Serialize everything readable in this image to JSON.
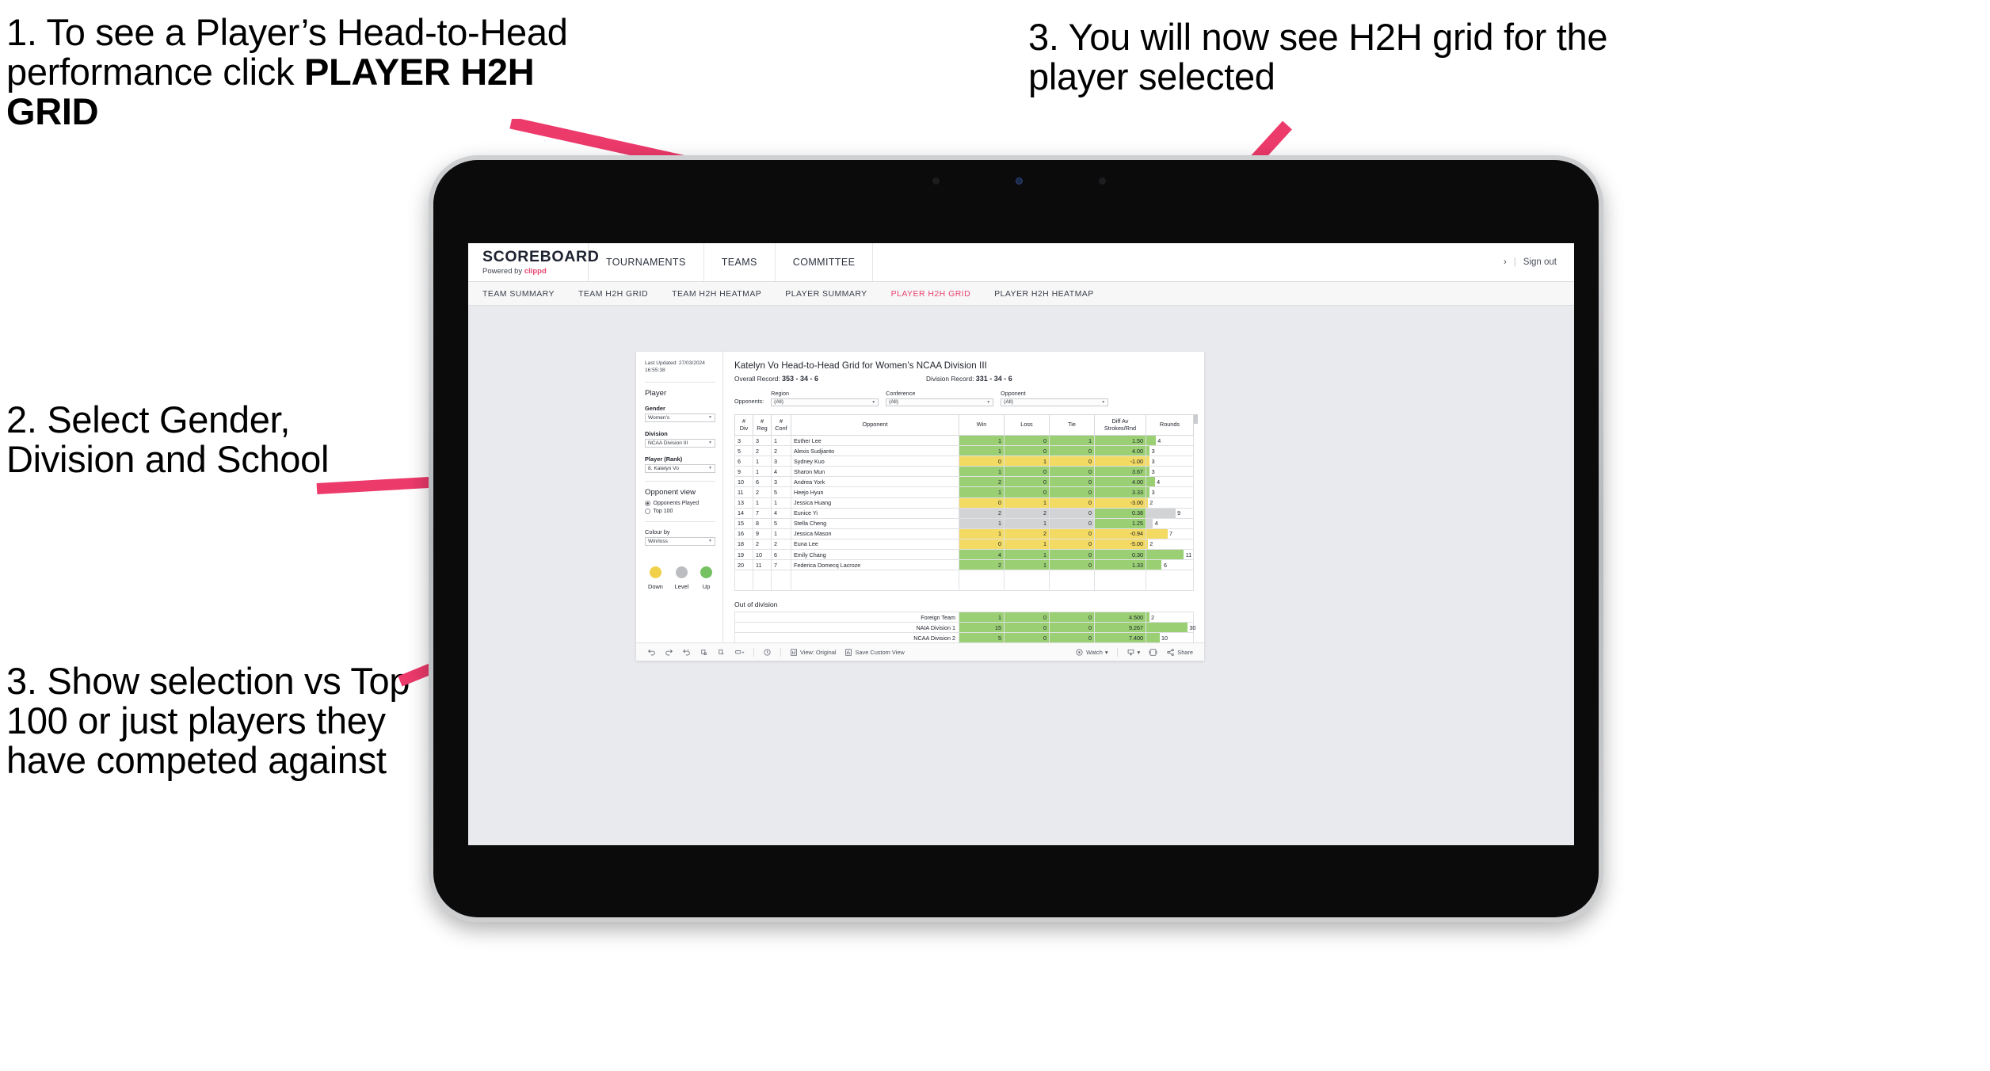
{
  "annotations": [
    {
      "id": "anno-1",
      "text_plain": "1. To see a Player’s Head-to-Head performance click ",
      "text_bold": "PLAYER H2H GRID"
    },
    {
      "id": "anno-2",
      "text": "2. Select Gender, Division and School"
    },
    {
      "id": "anno-3",
      "text": "3. Show selection vs Top 100 or just players they have competed against"
    },
    {
      "id": "anno-4",
      "text": "3. You will now see H2H grid for the player selected"
    }
  ],
  "arrow_color": "#ec3a6b",
  "app": {
    "brand": {
      "name": "SCOREBOARD",
      "sub_prefix": "Powered by ",
      "sub_brand": "clippd"
    },
    "topnav": [
      {
        "label": "TOURNAMENTS"
      },
      {
        "label": "TEAMS"
      },
      {
        "label": "COMMITTEE"
      }
    ],
    "topbar_right": {
      "chevron": "›",
      "separator": "|",
      "sign_out": "Sign out"
    },
    "subnav": [
      {
        "label": "TEAM SUMMARY",
        "active": false
      },
      {
        "label": "TEAM H2H GRID",
        "active": false
      },
      {
        "label": "TEAM H2H HEATMAP",
        "active": false
      },
      {
        "label": "PLAYER SUMMARY",
        "active": false
      },
      {
        "label": "PLAYER H2H GRID",
        "active": true
      },
      {
        "label": "PLAYER H2H HEATMAP",
        "active": false
      }
    ],
    "accent_color": "#e8436f"
  },
  "panel": {
    "last_updated": "Last Updated: 27/03/2024 16:55:38",
    "section_title": "Player",
    "filters": [
      {
        "label": "Gender",
        "value": "Women's"
      },
      {
        "label": "Division",
        "value": "NCAA Division III"
      },
      {
        "label": "Player (Rank)",
        "value": "8. Katelyn Vo"
      }
    ],
    "opponent_view": {
      "title": "Opponent view",
      "options": [
        {
          "label": "Opponents Played",
          "selected": true
        },
        {
          "label": "Top 100",
          "selected": false
        }
      ]
    },
    "colour_by": {
      "label": "Colour by",
      "value": "Win/loss"
    },
    "legend": [
      {
        "label": "Down",
        "color": "#f1d04a"
      },
      {
        "label": "Level",
        "color": "#bcbdc0"
      },
      {
        "label": "Up",
        "color": "#74c261"
      }
    ]
  },
  "content": {
    "title": "Katelyn Vo Head-to-Head Grid for Women’s NCAA Division III",
    "overall_record_label": "Overall Record:",
    "overall_record_value": "353 - 34 - 6",
    "division_record_label": "Division Record:",
    "division_record_value": "331 - 34 - 6",
    "opponents_label": "Opponents:",
    "opponent_filters": [
      {
        "label": "Region",
        "value": "(All)"
      },
      {
        "label": "Conference",
        "value": "(All)"
      },
      {
        "label": "Opponent",
        "value": "(All)"
      }
    ],
    "out_of_division_title": "Out of division"
  },
  "chart_data": {
    "type": "table",
    "title": "Katelyn Vo Head-to-Head Grid for Women’s NCAA Division III",
    "columns": [
      "# Div",
      "# Reg",
      "# Conf",
      "Opponent",
      "Win",
      "Loss",
      "Tie",
      "Diff Av Strokes/Rnd",
      "Rounds"
    ],
    "column_headers_multiline": [
      [
        "#",
        "Div"
      ],
      [
        "#",
        "Reg"
      ],
      [
        "#",
        "Conf"
      ],
      [
        "Opponent"
      ],
      [
        "Win"
      ],
      [
        "Loss"
      ],
      [
        "Tie"
      ],
      [
        "Diff Av",
        "Strokes/Rnd"
      ],
      [
        "Rounds"
      ]
    ],
    "rows": [
      {
        "div": "3",
        "reg": "3",
        "conf": "1",
        "opponent": "Esther Lee",
        "win": "1",
        "loss": "0",
        "tie": "1",
        "diff": "1.50",
        "rounds": "4",
        "state": "up",
        "rounds_pct": 20
      },
      {
        "div": "5",
        "reg": "2",
        "conf": "2",
        "opponent": "Alexis Sudjianto",
        "win": "1",
        "loss": "0",
        "tie": "0",
        "diff": "4.00",
        "rounds": "3",
        "state": "up",
        "rounds_pct": 7
      },
      {
        "div": "6",
        "reg": "1",
        "conf": "3",
        "opponent": "Sydney Kuo",
        "win": "0",
        "loss": "1",
        "tie": "0",
        "diff": "-1.00",
        "rounds": "3",
        "state": "down",
        "rounds_pct": 7
      },
      {
        "div": "9",
        "reg": "1",
        "conf": "4",
        "opponent": "Sharon Mun",
        "win": "1",
        "loss": "0",
        "tie": "0",
        "diff": "3.67",
        "rounds": "3",
        "state": "up",
        "rounds_pct": 7
      },
      {
        "div": "10",
        "reg": "6",
        "conf": "3",
        "opponent": "Andrea York",
        "win": "2",
        "loss": "0",
        "tie": "0",
        "diff": "4.00",
        "rounds": "4",
        "state": "up",
        "rounds_pct": 18
      },
      {
        "div": "11",
        "reg": "2",
        "conf": "5",
        "opponent": "Heejo Hyun",
        "win": "1",
        "loss": "0",
        "tie": "0",
        "diff": "3.33",
        "rounds": "3",
        "state": "up",
        "rounds_pct": 7
      },
      {
        "div": "13",
        "reg": "1",
        "conf": "1",
        "opponent": "Jessica Huang",
        "win": "0",
        "loss": "1",
        "tie": "0",
        "diff": "-3.00",
        "rounds": "2",
        "state": "down",
        "rounds_pct": 3
      },
      {
        "div": "14",
        "reg": "7",
        "conf": "4",
        "opponent": "Eunice Yi",
        "win": "2",
        "loss": "2",
        "tie": "0",
        "diff": "0.38",
        "rounds": "9",
        "state": "level",
        "rounds_pct": 62,
        "diff_state": "up"
      },
      {
        "div": "15",
        "reg": "8",
        "conf": "5",
        "opponent": "Stella Cheng",
        "win": "1",
        "loss": "1",
        "tie": "0",
        "diff": "1.25",
        "rounds": "4",
        "state": "level",
        "rounds_pct": 14,
        "diff_state": "up"
      },
      {
        "div": "16",
        "reg": "9",
        "conf": "1",
        "opponent": "Jessica Mason",
        "win": "1",
        "loss": "2",
        "tie": "0",
        "diff": "-0.94",
        "rounds": "7",
        "state": "down",
        "rounds_pct": 45
      },
      {
        "div": "18",
        "reg": "2",
        "conf": "2",
        "opponent": "Euna Lee",
        "win": "0",
        "loss": "1",
        "tie": "0",
        "diff": "-5.00",
        "rounds": "2",
        "state": "down",
        "rounds_pct": 3
      },
      {
        "div": "19",
        "reg": "10",
        "conf": "6",
        "opponent": "Emily Chang",
        "win": "4",
        "loss": "1",
        "tie": "0",
        "diff": "0.30",
        "rounds": "11",
        "state": "up",
        "rounds_pct": 80
      },
      {
        "div": "20",
        "reg": "11",
        "conf": "7",
        "opponent": "Federica Domecq Lacroze",
        "win": "2",
        "loss": "1",
        "tie": "0",
        "diff": "1.33",
        "rounds": "6",
        "state": "up",
        "rounds_pct": 33
      }
    ],
    "out_of_division": [
      {
        "name": "Foreign Team",
        "win": "1",
        "loss": "0",
        "tie": "0",
        "diff": "4.500",
        "rounds": "2",
        "state": "up",
        "rounds_pct": 6
      },
      {
        "name": "NAIA Division 1",
        "win": "15",
        "loss": "0",
        "tie": "0",
        "diff": "9.267",
        "rounds": "30",
        "state": "up",
        "rounds_pct": 88
      },
      {
        "name": "NCAA Division 2",
        "win": "5",
        "loss": "0",
        "tie": "0",
        "diff": "7.400",
        "rounds": "10",
        "state": "up",
        "rounds_pct": 28
      }
    ],
    "colors": {
      "up": "#9ad073",
      "down": "#f3da62",
      "level": "#d2d3d5",
      "none": "#ffffff"
    }
  },
  "toolbar": {
    "view_label": "View: Original",
    "save_label": "Save Custom View",
    "watch_label": "Watch",
    "share_label": "Share",
    "caret": "▾"
  }
}
